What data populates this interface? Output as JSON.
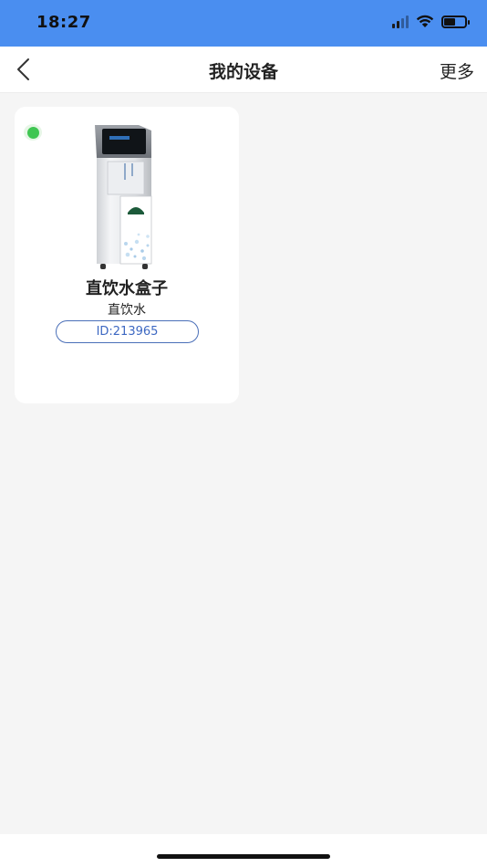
{
  "status_bar": {
    "time": "18:27",
    "icons": [
      "cellular-signal-icon",
      "wifi-icon",
      "battery-icon"
    ],
    "battery_level": 0.55,
    "background_color": "#4a8ef0"
  },
  "nav": {
    "title": "我的设备",
    "more_label": "更多",
    "back_icon": "chevron-left-icon"
  },
  "devices": [
    {
      "name": "直饮水盒子",
      "type": "直饮水",
      "id_label": "ID:213965",
      "online": true,
      "status_color": "#3fc652",
      "image": "water-dispenser-image"
    }
  ],
  "colors": {
    "accent": "#3d68c2",
    "page_background": "#f5f5f5"
  }
}
